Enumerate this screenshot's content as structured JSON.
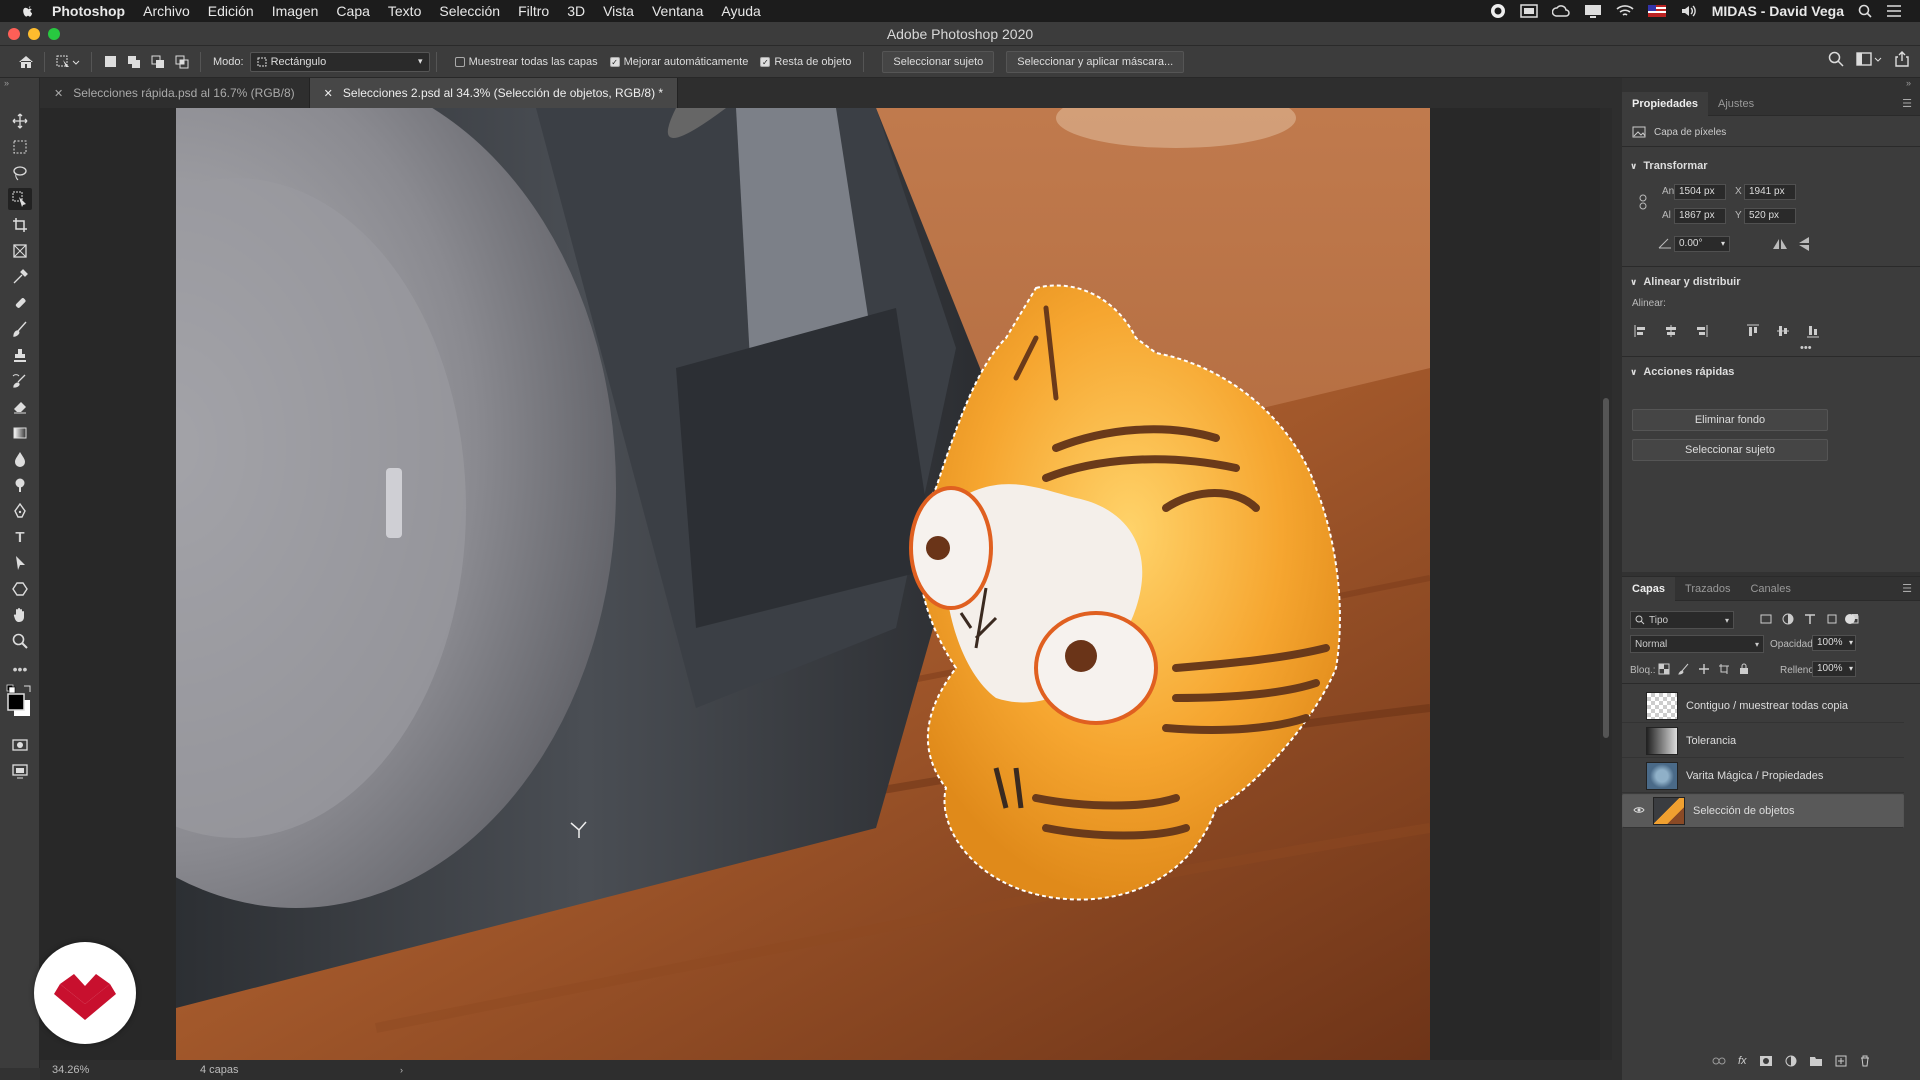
{
  "menubar": {
    "app": "Photoshop",
    "items": [
      "Archivo",
      "Edición",
      "Imagen",
      "Capa",
      "Texto",
      "Selección",
      "Filtro",
      "3D",
      "Vista",
      "Ventana",
      "Ayuda"
    ],
    "user": "MIDAS - David Vega"
  },
  "window": {
    "title": "Adobe Photoshop 2020"
  },
  "options": {
    "mode_label": "Modo:",
    "mode_value": "Rectángulo",
    "check_sample_all": "Muestrear todas las capas",
    "check_auto_enhance": "Mejorar automáticamente",
    "check_object_subtract": "Resta de objeto",
    "btn_select_subject": "Seleccionar sujeto",
    "btn_select_mask": "Seleccionar y aplicar máscara..."
  },
  "tabs": [
    {
      "label": "Selecciones rápida.psd al 16.7% (RGB/8)"
    },
    {
      "label": "Selecciones 2.psd al 34.3% (Selección de objetos, RGB/8) *"
    }
  ],
  "status": {
    "zoom": "34.26%",
    "info": "4 capas"
  },
  "properties": {
    "tab_props": "Propiedades",
    "tab_adjust": "Ajustes",
    "layer_kind": "Capa de píxeles",
    "transform_title": "Transformar",
    "an_label": "An",
    "an_value": "1504 px",
    "x_label": "X",
    "x_value": "1941 px",
    "al_label": "Al",
    "al_value": "1867 px",
    "y_label": "Y",
    "y_value": "520 px",
    "angle_value": "0.00°",
    "align_title": "Alinear y distribuir",
    "align_label": "Alinear:",
    "quick_title": "Acciones rápidas",
    "btn_remove_bg": "Eliminar fondo",
    "btn_select_subject": "Seleccionar sujeto"
  },
  "layers_panel": {
    "tab_layers": "Capas",
    "tab_paths": "Trazados",
    "tab_channels": "Canales",
    "filter": "Tipo",
    "blend": "Normal",
    "opacity_label": "Opacidad:",
    "opacity": "100%",
    "lock_label": "Bloq.:",
    "fill_label": "Relleno:",
    "fill": "100%",
    "layers": [
      {
        "name": "Contiguo / muestrear todas copia",
        "visible": false
      },
      {
        "name": "Tolerancia",
        "visible": false
      },
      {
        "name": "Varita Mágica / Propiedades",
        "visible": false
      },
      {
        "name": "Selección de objetos",
        "visible": true
      }
    ]
  },
  "colors": {
    "accent": "#c8102e"
  }
}
